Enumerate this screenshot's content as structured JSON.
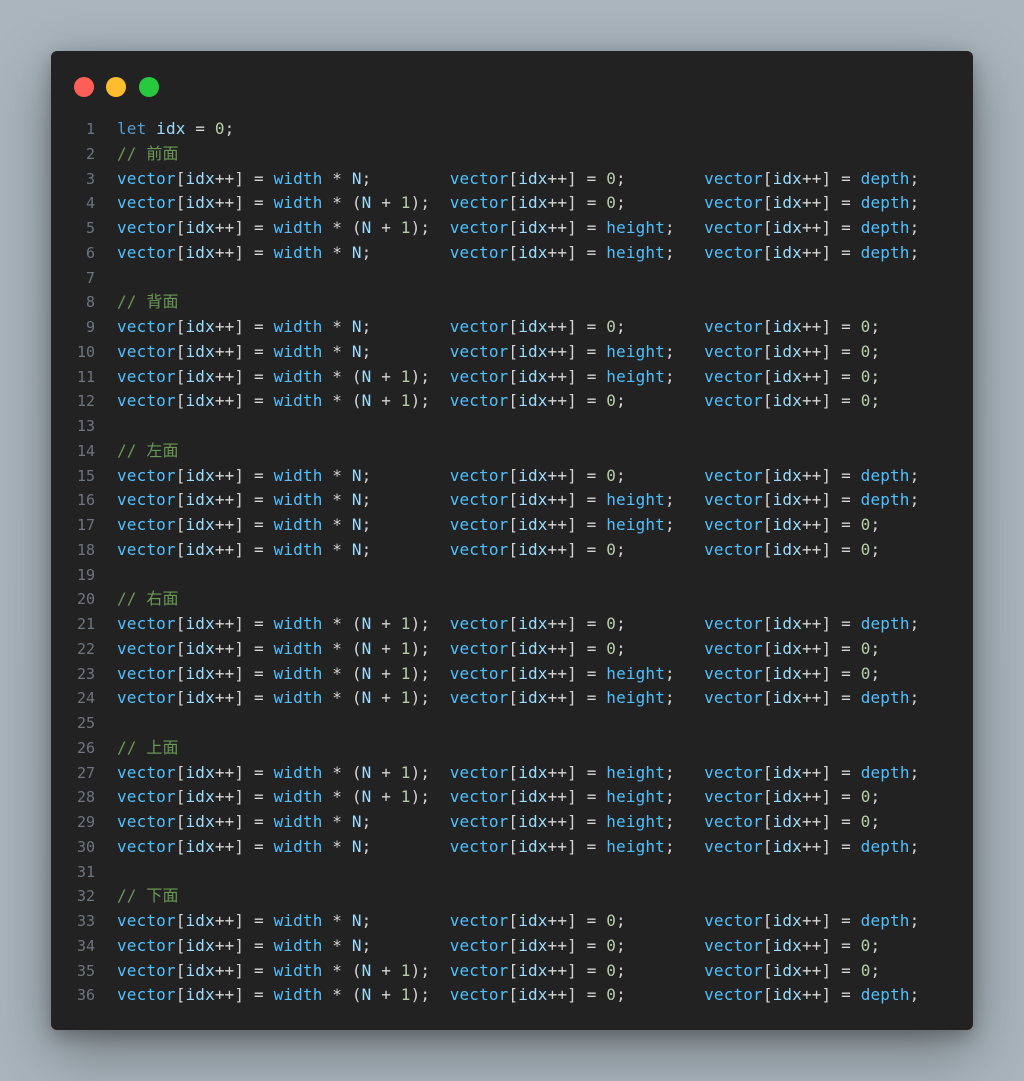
{
  "window": {
    "controls": [
      "close",
      "minimize",
      "maximize"
    ],
    "colors": {
      "close": "#ff5f56",
      "minimize": "#ffbd2e",
      "maximize": "#27c93f",
      "background": "#222222"
    }
  },
  "code": {
    "language": "javascript",
    "lines": [
      "let idx = 0;",
      "// 前面",
      "vector[idx++] = width * N;        vector[idx++] = 0;        vector[idx++] = depth;",
      "vector[idx++] = width * (N + 1);  vector[idx++] = 0;        vector[idx++] = depth;",
      "vector[idx++] = width * (N + 1);  vector[idx++] = height;   vector[idx++] = depth;",
      "vector[idx++] = width * N;        vector[idx++] = height;   vector[idx++] = depth;",
      "",
      "// 背面",
      "vector[idx++] = width * N;        vector[idx++] = 0;        vector[idx++] = 0;",
      "vector[idx++] = width * N;        vector[idx++] = height;   vector[idx++] = 0;",
      "vector[idx++] = width * (N + 1);  vector[idx++] = height;   vector[idx++] = 0;",
      "vector[idx++] = width * (N + 1);  vector[idx++] = 0;        vector[idx++] = 0;",
      "",
      "// 左面",
      "vector[idx++] = width * N;        vector[idx++] = 0;        vector[idx++] = depth;",
      "vector[idx++] = width * N;        vector[idx++] = height;   vector[idx++] = depth;",
      "vector[idx++] = width * N;        vector[idx++] = height;   vector[idx++] = 0;",
      "vector[idx++] = width * N;        vector[idx++] = 0;        vector[idx++] = 0;",
      "",
      "// 右面",
      "vector[idx++] = width * (N + 1);  vector[idx++] = 0;        vector[idx++] = depth;",
      "vector[idx++] = width * (N + 1);  vector[idx++] = 0;        vector[idx++] = 0;",
      "vector[idx++] = width * (N + 1);  vector[idx++] = height;   vector[idx++] = 0;",
      "vector[idx++] = width * (N + 1);  vector[idx++] = height;   vector[idx++] = depth;",
      "",
      "// 上面",
      "vector[idx++] = width * (N + 1);  vector[idx++] = height;   vector[idx++] = depth;",
      "vector[idx++] = width * (N + 1);  vector[idx++] = height;   vector[idx++] = 0;",
      "vector[idx++] = width * N;        vector[idx++] = height;   vector[idx++] = 0;",
      "vector[idx++] = width * N;        vector[idx++] = height;   vector[idx++] = depth;",
      "",
      "// 下面",
      "vector[idx++] = width * N;        vector[idx++] = 0;        vector[idx++] = depth;",
      "vector[idx++] = width * N;        vector[idx++] = 0;        vector[idx++] = 0;",
      "vector[idx++] = width * (N + 1);  vector[idx++] = 0;        vector[idx++] = 0;",
      "vector[idx++] = width * (N + 1);  vector[idx++] = 0;        vector[idx++] = depth;"
    ]
  }
}
